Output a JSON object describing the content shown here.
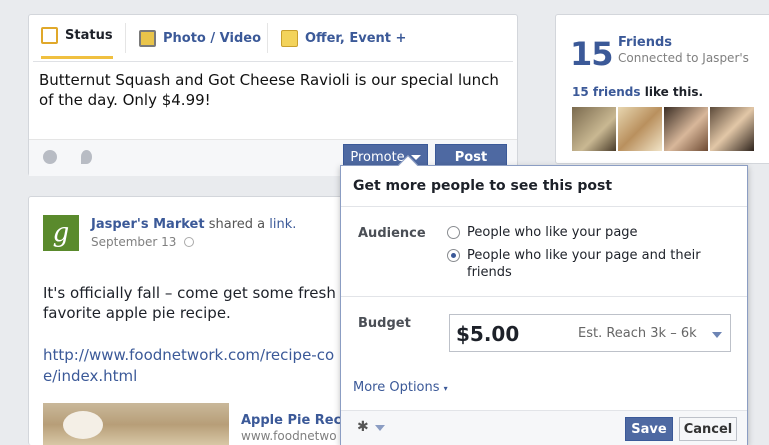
{
  "composer": {
    "tabs": [
      {
        "label": "Status",
        "icon": "status-icon"
      },
      {
        "label": "Photo / Video",
        "icon": "photo-icon"
      },
      {
        "label": "Offer, Event +",
        "icon": "offer-icon"
      }
    ],
    "text": "Butternut Squash and Got Cheese Ravioli is our special lunch of the day. Only $4.99!",
    "promote_label": "Promote",
    "post_label": "Post"
  },
  "friends": {
    "count": "15",
    "label": "Friends",
    "sub": "Connected to Jasper's",
    "likes_link": "15 friends",
    "likes_rest": " like this."
  },
  "post": {
    "logo_letter": "g",
    "page_name": "Jasper's Market",
    "shared_text": " shared a ",
    "link_word": "link.",
    "date": "September 13",
    "body": "It's officially fall – come get some fresh favorite apple pie recipe.",
    "url": "http://www.foodnetwork.com/recipe-co pie/index.html",
    "link_title": "Apple Pie Reci",
    "link_domain": "www.foodnetwo"
  },
  "promote": {
    "title": "Get more people to see this post",
    "audience_label": "Audience",
    "audience_options": [
      {
        "label": "People who like your page",
        "selected": false
      },
      {
        "label": "People who like your page and their friends",
        "selected": true
      }
    ],
    "budget_label": "Budget",
    "budget_amount": "$5.00",
    "est_reach": "Est. Reach 3k – 6k",
    "more_options": "More Options",
    "save_label": "Save",
    "cancel_label": "Cancel"
  },
  "sidebar_fragment": "a",
  "colors": {
    "brand": "#3b5998",
    "button": "#4e69a2"
  }
}
